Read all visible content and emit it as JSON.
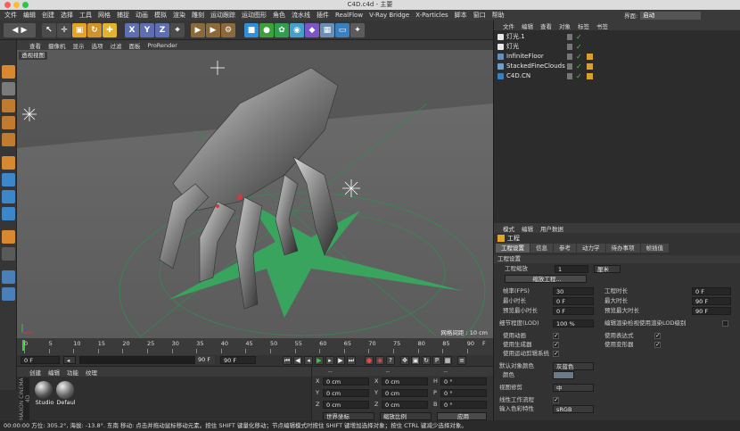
{
  "window": {
    "title": "C4D.c4d - 主要"
  },
  "menu": [
    "文件",
    "编辑",
    "创建",
    "选择",
    "工具",
    "网格",
    "捕捉",
    "动画",
    "模拟",
    "渲染",
    "雕刻",
    "运动跟踪",
    "运动图形",
    "角色",
    "流水线",
    "插件",
    "RealFlow",
    "V-Ray Bridge",
    "X-Particles",
    "脚本",
    "窗口",
    "帮助"
  ],
  "layout": {
    "label": "界面:",
    "value": "启动"
  },
  "viewport": {
    "menu": [
      "查看",
      "摄像机",
      "显示",
      "选项",
      "过滤",
      "面板",
      "ProRender"
    ],
    "label": "透视视图",
    "grid_info": "网格间距 : 10 cm"
  },
  "timeline": {
    "ticks": [
      "0",
      "5",
      "10",
      "15",
      "20",
      "25",
      "30",
      "35",
      "40",
      "45",
      "50",
      "55",
      "60",
      "65",
      "70",
      "75",
      "80",
      "85",
      "90"
    ],
    "unit": "F",
    "start": "0 F",
    "current": "0 F",
    "end": "90 F",
    "max": "90 F"
  },
  "materials": {
    "menu": [
      "创建",
      "编辑",
      "功能",
      "纹理"
    ],
    "items": [
      "Studio",
      "Defaul"
    ],
    "brand": "MAXON CINEMA 4D"
  },
  "coords": {
    "rows": [
      [
        "X",
        "0 cm",
        "X",
        "0 cm",
        "H",
        "0 °"
      ],
      [
        "Y",
        "0 cm",
        "Y",
        "0 cm",
        "P",
        "0 °"
      ],
      [
        "Z",
        "0 cm",
        "Z",
        "0 cm",
        "B",
        "0 °"
      ]
    ],
    "dash": "--",
    "mode1": "世界坐标",
    "mode2": "缩放比例",
    "apply": "应用"
  },
  "objects": {
    "menu": [
      "文件",
      "编辑",
      "查看",
      "对象",
      "标签",
      "书签"
    ],
    "items": [
      "灯光.1",
      "灯光",
      "InfiniteFloor",
      "StackedFineClouds",
      "C4D.CN"
    ]
  },
  "attributes": {
    "menu": [
      "模式",
      "编辑",
      "用户数据"
    ],
    "header": "工程",
    "tabs": [
      "工程设置",
      "信息",
      "参考",
      "动力学",
      "待办事项",
      "帧插值"
    ],
    "section": "工程设置",
    "scale_label": "工程缩放",
    "scale_value": "1",
    "scale_unit": "厘米",
    "scale_btn": "缩放工程...",
    "fps_label": "帧率(FPS)",
    "fps": "30",
    "duration_label": "工程时长",
    "duration": "0 F",
    "min_label": "最小时长",
    "min": "0 F",
    "max_label": "最大时长",
    "max": "90 F",
    "pmin_label": "预览最小时长",
    "pmin": "0 F",
    "pmax_label": "预览最大时长",
    "pmax": "90 F",
    "lod_label": "细节程度(LOD)",
    "lod": "100 %",
    "lod_render": "编辑渲染检视使用渲染LOD级别",
    "anim": "使用动画",
    "expr": "使用表达式",
    "gen": "使用生成器",
    "deform": "使用变形器",
    "motion": "使用运动剪辑系统",
    "color_label": "默认对象颜色",
    "color_value": "灰蓝色",
    "color2": "颜色",
    "clip_label": "视图修剪",
    "clip_value": "中",
    "linear": "线性工作流程",
    "input_label": "输入色彩特性",
    "input_value": "sRGB"
  },
  "status": "00:00:00  方位: 305.2°, 海拔: -13.8°. 东南  移动: 点击并拖动鼠标移动元素。按住 SHIFT 键量化移动；节点编辑模式时按住 SHIFT 键增加选择对象；按住 CTRL 键减少选择对象。"
}
